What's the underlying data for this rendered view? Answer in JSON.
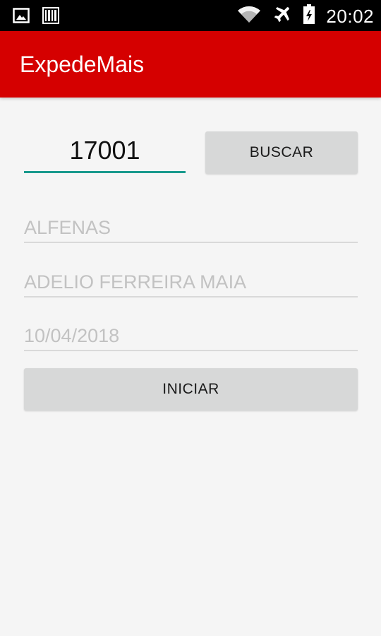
{
  "status_bar": {
    "time": "20:02",
    "icons": [
      "image-icon",
      "barcode-icon",
      "wifi-icon",
      "airplane-icon",
      "battery-icon"
    ]
  },
  "app_bar": {
    "title": "ExpedeMais",
    "color": "#d50000"
  },
  "form": {
    "cep_value": "17001",
    "search_button": "BUSCAR",
    "city_value": "ALFENAS",
    "name_value": "ADELIO FERREIRA MAIA",
    "date_value": "10/04/2018",
    "start_button": "INICIAR",
    "accent_color": "#199a8d"
  }
}
